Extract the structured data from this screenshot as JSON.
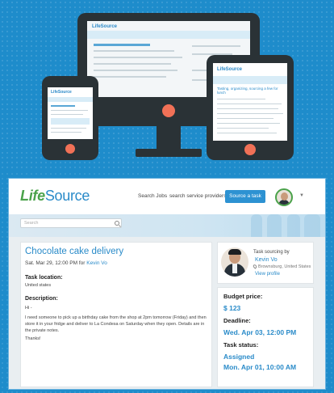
{
  "colors": {
    "brand_blue": "#2a8bc9",
    "brand_green": "#4aa24a",
    "accent_orange": "#f17157",
    "bg_blue": "#1e8ccb"
  },
  "preview": {
    "monitor_logo": "LifeSource",
    "tablet_logo": "LifeSource",
    "phone_logo": "LifeSource",
    "tablet_heading": "Tasting, organizing, sourcing a few for lunch"
  },
  "nav": {
    "logo_life": "Life",
    "logo_source": "Source",
    "search_jobs": "Search Jobs",
    "search_providers": "search service providers",
    "cta_label": "Source a task",
    "avatar_icon": "user-avatar",
    "menu_icon": "chevron-down-icon"
  },
  "search": {
    "placeholder": "Search"
  },
  "task": {
    "title": "Chocolate cake delivery",
    "date": "Sat. Mar 29, 12:00 PM for ",
    "for_user": "Kevin Vo",
    "location_label": "Task location:",
    "location_value": "United states",
    "description_label": "Description:",
    "description_greeting": "Hi -",
    "description_body": "I need someone to pick up a birthday cake from the shop at 2pm tomorrow (Friday) and then store it in your fridge and deliver to La Condesa on Saturday when they open. Details are in the private notes.",
    "description_closing": "Thanks!"
  },
  "sourcer": {
    "label": "Task sourcing by",
    "name": "Kevin Vo",
    "location": "Brownsburg, United States",
    "view_profile": "View profile"
  },
  "details": {
    "budget_label": "Budget price:",
    "budget_value": "$ 123",
    "deadline_label": "Deadline:",
    "deadline_value": "Wed. Apr 03, 12:00 PM",
    "status_label": "Task status:",
    "status_value": "Assigned",
    "status_date": "Mon. Apr 01, 10:00 AM"
  }
}
